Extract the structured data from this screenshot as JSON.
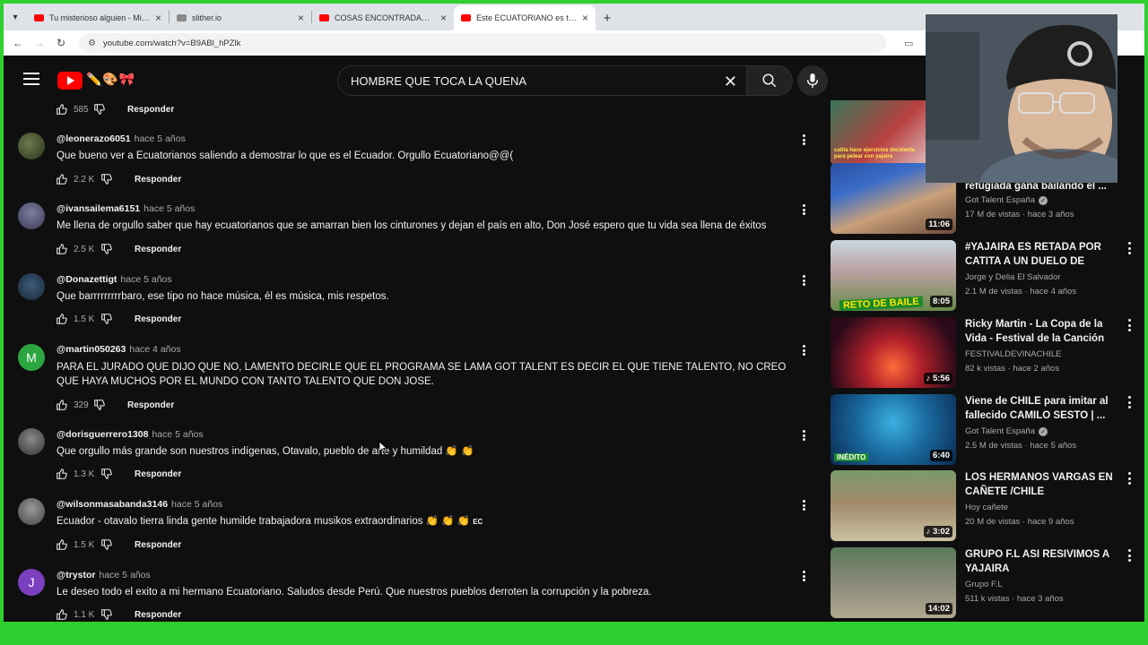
{
  "browser": {
    "tabs": [
      {
        "title": "Tu misterioso alguien - Mirand",
        "icon": "youtube-icon",
        "active": false
      },
      {
        "title": "slither.io",
        "icon": "slither-icon",
        "active": false
      },
      {
        "title": "COSAS ENCONTRADAS EN EL C",
        "icon": "youtube-icon",
        "active": false
      },
      {
        "title": "Este ECUATORIANO es todo un",
        "icon": "youtube-icon",
        "active": true
      }
    ],
    "url": "youtube.com/watch?v=B9ABl_hPZlk"
  },
  "header": {
    "search_value": "HOMBRE QUE TOCA LA QUENA"
  },
  "comments": {
    "top_partial": {
      "likes": "585",
      "reply_label": "Responder"
    },
    "items": [
      {
        "handle": "@leonerazo6051",
        "time": "hace 5 años",
        "text": "Que bueno ver a Ecuatorianos saliendo a demostrar lo que es el Ecuador. Orgullo Ecuatoriano@@(",
        "likes": "2.2 K",
        "reply_label": "Responder",
        "avatar_letter": ""
      },
      {
        "handle": "@ivansailema6151",
        "time": "hace 5 años",
        "text": "Me llena de orgullo saber que hay ecuatorianos que se amarran bien los cinturones y dejan el país en alto, Don José espero que tu vida sea llena de éxitos",
        "likes": "2.5 K",
        "reply_label": "Responder",
        "avatar_letter": ""
      },
      {
        "handle": "@Donazettigt",
        "time": "hace 5 años",
        "text": "Que barrrrrrrrrbaro, ese tipo no hace música, él es música, mis respetos.",
        "likes": "1.5 K",
        "reply_label": "Responder",
        "avatar_letter": ""
      },
      {
        "handle": "@martin050263",
        "time": "hace 4 años",
        "text": "PARA EL JURADO QUE DIJO QUE NO, LAMENTO DECIRLE QUE EL PROGRAMA SE LAMA GOT TALENT ES DECIR EL QUE TIENE TALENTO, NO CREO QUE HAYA MUCHOS POR EL MUNDO CON TANTO TALENTO QUE DON JOSE.",
        "likes": "329",
        "reply_label": "Responder",
        "avatar_letter": "M"
      },
      {
        "handle": "@dorisguerrero1308",
        "time": "hace 5 años",
        "text": "Que orgullo más grande son nuestros indígenas, Otavalo, pueblo de arte y humildad 👏 👏",
        "likes": "1.3 K",
        "reply_label": "Responder",
        "avatar_letter": ""
      },
      {
        "handle": "@wilsonmasabanda3146",
        "time": "hace 5 años",
        "text": "Ecuador - otavalo  tierra linda gente humilde trabajadora musikos extraordinarios 👏 👏 👏",
        "flag": "EC",
        "likes": "1.5 K",
        "reply_label": "Responder",
        "avatar_letter": ""
      },
      {
        "handle": "@trystor",
        "time": "hace 5 años",
        "text": "Le deseo todo el exito a mi hermano Ecuatoriano. Saludos desde Perú. Que nuestros pueblos derroten la corrupción y la pobreza.",
        "likes": "1.1 K",
        "reply_label": "Responder",
        "avatar_letter": "J"
      }
    ]
  },
  "sidebar": {
    "videos": [
      {
        "title": "refugiada gana bailando el ...",
        "channel": "Got Talent España",
        "verified": true,
        "meta": "17 M de vistas · hace 3 años",
        "duration": "11:06"
      },
      {
        "title": "#YAJAIRA ES RETADA POR CATITA A UN DUELO DE BAILE...",
        "channel": "Jorge y Delia El Salvador",
        "verified": false,
        "meta": "2.1 M de vistas · hace 4 años",
        "duration": "8:05",
        "thumb_text": "RETO DE BAILE"
      },
      {
        "title": "Ricky Martin - La Copa de la Vida - Festival de la Canción d...",
        "channel": "FESTIVALDEVINACHILE",
        "verified": false,
        "meta": "82 k vistas · hace 2 años",
        "duration": "5:56"
      },
      {
        "title": "Viene de CHILE para imitar al fallecido CAMILO SESTO | ...",
        "channel": "Got Talent España",
        "verified": true,
        "meta": "2.5 M de vistas · hace 5 años",
        "duration": "6:40",
        "thumb_text": "INÉDITO"
      },
      {
        "title": "LOS HERMANOS VARGAS EN CAÑETE /CHILE",
        "channel": "Hoy cañete",
        "verified": false,
        "meta": "20 M de vistas · hace 9 años",
        "duration": "3:02"
      },
      {
        "title": "GRUPO F.L ASI RESIVIMOS A YAJAIRA",
        "channel": "Grupo F.L",
        "verified": false,
        "meta": "511 k vistas · hace 3 años",
        "duration": "14:02"
      }
    ],
    "partial_top_thumb_text": "catita hace ejercicios decidente para pelear con yajaira"
  },
  "colors": {
    "background": "#0f0f0f",
    "text": "#f1f1f1",
    "secondary": "#aaaaaa",
    "brand": "#ff0000",
    "screen_border": "#2ecf2e"
  }
}
